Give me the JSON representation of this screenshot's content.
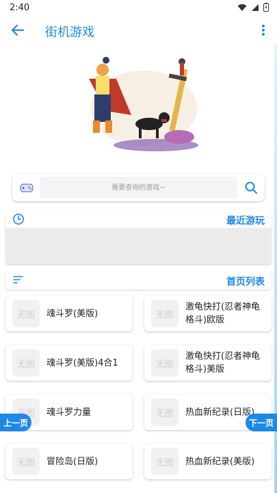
{
  "status": {
    "time": "2:40"
  },
  "appbar": {
    "title": "街机游戏"
  },
  "search": {
    "placeholder": "需要查询的游戏~"
  },
  "recent": {
    "title": "最近游玩"
  },
  "home": {
    "title": "首页列表"
  },
  "thumb_placeholder": "无图",
  "games": [
    {
      "name": "魂斗罗(美版)"
    },
    {
      "name": "激龟快打(忍者神龟格斗)欧版"
    },
    {
      "name": "魂斗罗(美版)4合1"
    },
    {
      "name": "激龟快打(忍者神龟格斗)美版"
    },
    {
      "name": "魂斗罗力量"
    },
    {
      "name": "热血新纪录(日版)"
    },
    {
      "name": "冒险岛(日版)"
    },
    {
      "name": "热血新纪录(美版)"
    }
  ],
  "pager": {
    "prev": "上一页",
    "next": "下一页"
  },
  "colors": {
    "accent": "#1e88e5"
  }
}
